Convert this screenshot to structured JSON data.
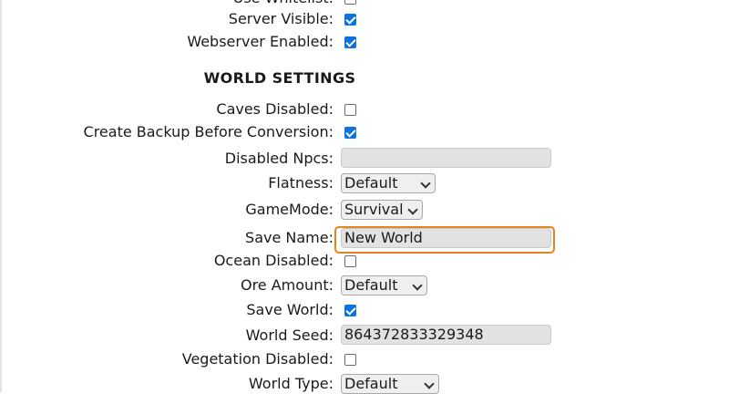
{
  "server_settings": {
    "use_whitelist": {
      "label": "Use Whitelist:",
      "checked": false
    },
    "server_visible": {
      "label": "Server Visible:",
      "checked": true
    },
    "webserver_enabled": {
      "label": "Webserver Enabled:",
      "checked": true
    }
  },
  "world_settings": {
    "title": "WORLD SETTINGS",
    "caves_disabled": {
      "label": "Caves Disabled:",
      "checked": false
    },
    "create_backup": {
      "label": "Create Backup Before Conversion:",
      "checked": true
    },
    "disabled_npcs": {
      "label": "Disabled Npcs:",
      "value": ""
    },
    "flatness": {
      "label": "Flatness:",
      "value": "Default"
    },
    "gamemode": {
      "label": "GameMode:",
      "value": "Survival"
    },
    "save_name": {
      "label": "Save Name:",
      "value": "New World"
    },
    "ocean_disabled": {
      "label": "Ocean Disabled:",
      "checked": false
    },
    "ore_amount": {
      "label": "Ore Amount:",
      "value": "Default"
    },
    "save_world": {
      "label": "Save World:",
      "checked": true
    },
    "world_seed": {
      "label": "World Seed:",
      "value": "864372833329348"
    },
    "vegetation_disabled": {
      "label": "Vegetation Disabled:",
      "checked": false
    },
    "world_type": {
      "label": "World Type:",
      "value": "Default"
    }
  },
  "colors": {
    "focus": "#e8821e",
    "checkbox_on": "#0b73e0"
  }
}
